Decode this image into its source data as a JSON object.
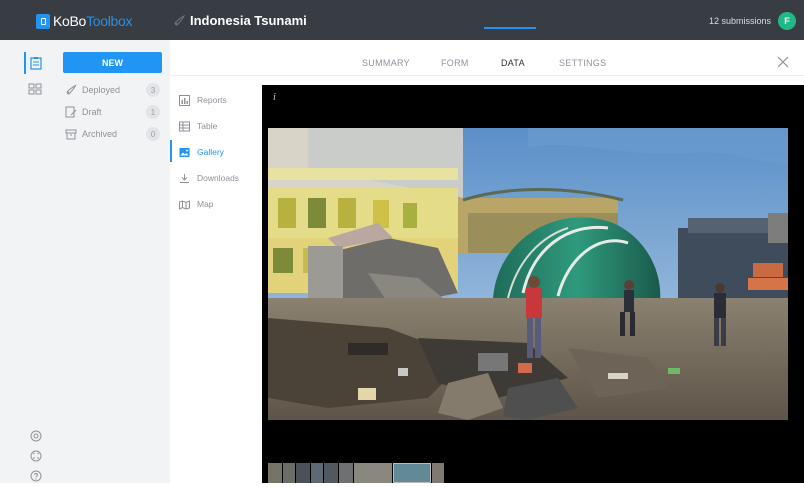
{
  "app": {
    "logo_kobo": "KoBo",
    "logo_toolbox": "Toolbox",
    "project_title": "Indonesia Tsunami",
    "submissions": "12 submissions",
    "avatar_initial": "F"
  },
  "sidebar": {
    "new_label": "NEW",
    "items": [
      {
        "label": "Deployed",
        "count": "3",
        "icon": "rocket-icon"
      },
      {
        "label": "Draft",
        "count": "1",
        "icon": "draft-icon"
      },
      {
        "label": "Archived",
        "count": "0",
        "icon": "archive-icon"
      }
    ]
  },
  "tabs": [
    {
      "label": "SUMMARY"
    },
    {
      "label": "FORM"
    },
    {
      "label": "DATA",
      "active": true
    },
    {
      "label": "SETTINGS"
    }
  ],
  "data_nav": [
    {
      "label": "Reports",
      "icon": "reports-icon"
    },
    {
      "label": "Table",
      "icon": "table-icon"
    },
    {
      "label": "Gallery",
      "icon": "gallery-icon",
      "active": true
    },
    {
      "label": "Downloads",
      "icon": "download-icon"
    },
    {
      "label": "Map",
      "icon": "map-icon"
    }
  ],
  "viewer": {
    "info_symbol": "i"
  },
  "colors": {
    "topbar": "#383c43",
    "accent": "#2095f3",
    "avatar": "#20b986"
  }
}
